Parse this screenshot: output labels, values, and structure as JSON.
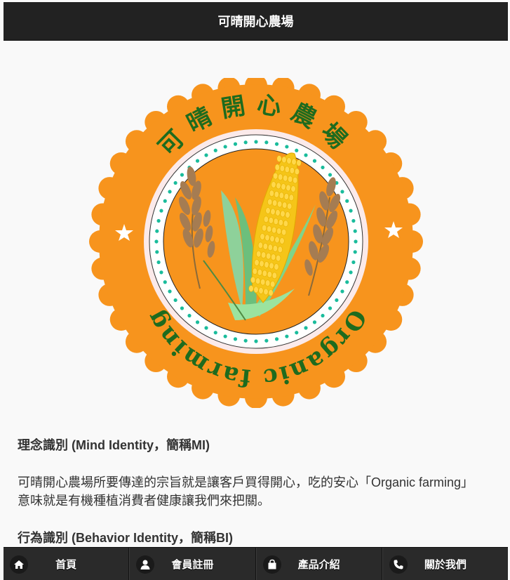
{
  "header": {
    "title": "可晴開心農場"
  },
  "logo": {
    "top_text": "可晴開心農場",
    "bottom_text": "Organic farming",
    "colors": {
      "orange": "#f7941d",
      "ring": "#fce4ec",
      "dots": "#1abc9c",
      "text": "#1e6b1e"
    }
  },
  "content": {
    "mi_title": "理念識別 (Mind Identity，簡稱MI)",
    "mi_text": "可晴開心農場所要傳達的宗旨就是讓客戶買得開心，吃的安心「Organic farming」意味就是有機種植消費者健康讓我們來把關。",
    "bi_title": "行為識別 (Behavior Identity，簡稱BI)"
  },
  "footer": {
    "items": [
      {
        "label": "首頁",
        "icon": "home-icon"
      },
      {
        "label": "會員註冊",
        "icon": "user-icon"
      },
      {
        "label": "產品介紹",
        "icon": "bag-icon"
      },
      {
        "label": "關於我們",
        "icon": "phone-icon"
      }
    ]
  }
}
